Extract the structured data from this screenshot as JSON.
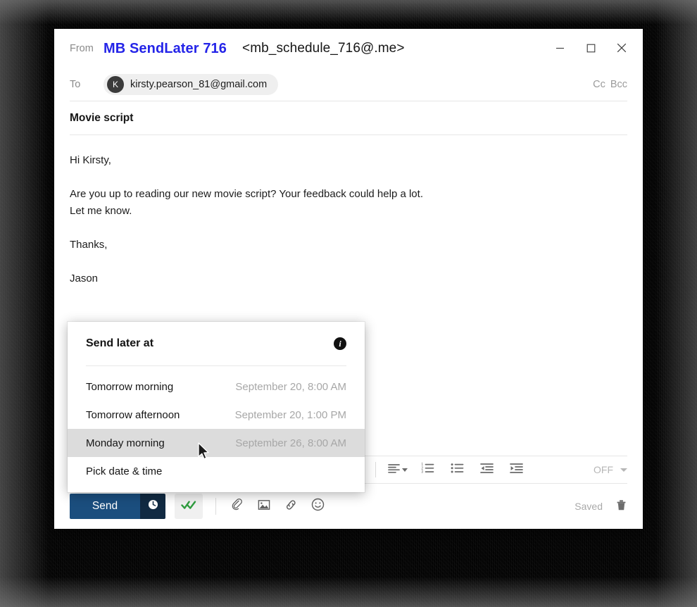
{
  "window": {
    "controls": [
      {
        "name": "minimize",
        "glyph": "minimize-icon"
      },
      {
        "name": "maximize",
        "glyph": "maximize-icon"
      },
      {
        "name": "close",
        "glyph": "close-icon"
      }
    ]
  },
  "compose": {
    "from_label": "From",
    "from_name": "MB SendLater 716",
    "from_address": "<mb_schedule_716@.me>",
    "from_name_color": "#2424e8",
    "to_label": "To",
    "to_avatar_initial": "K",
    "to_email": "kirsty.pearson_81@gmail.com",
    "cc_label": "Cc",
    "bcc_label": "Bcc",
    "subject": "Movie script",
    "body_lines": [
      "Hi Kirsty,",
      "",
      "Are you up to reading our new movie script? Your feedback could help a lot.",
      "Let me know.",
      "",
      "Thanks,",
      "",
      "Jason"
    ]
  },
  "format_toolbar": {
    "buttons": [
      {
        "name": "align-left-icon",
        "label": "Align"
      },
      {
        "name": "numbered-list-icon",
        "label": "Numbered list"
      },
      {
        "name": "bulleted-list-icon",
        "label": "Bulleted list"
      },
      {
        "name": "decrease-indent-icon",
        "label": "Decrease indent"
      },
      {
        "name": "increase-indent-icon",
        "label": "Increase indent"
      }
    ],
    "tracking_value": "OFF"
  },
  "send_bar": {
    "send_label": "Send",
    "clock_icon": "clock-icon",
    "send_later_icon": "double-check-icon",
    "send_later_color": "#2e9c3e",
    "send_button_color": "#1b4e7e",
    "send_clock_color": "#112a42",
    "attach_buttons": [
      {
        "name": "paperclip-icon",
        "label": "Attach file"
      },
      {
        "name": "image-icon",
        "label": "Insert image"
      },
      {
        "name": "link-icon",
        "label": "Insert link"
      },
      {
        "name": "emoji-icon",
        "label": "Insert emoji"
      }
    ],
    "saved_text": "Saved",
    "trash_icon": "trash-icon"
  },
  "dropdown": {
    "title": "Send later at",
    "info_icon": "info-icon",
    "info_glyph": "i",
    "items": [
      {
        "label": "Tomorrow morning",
        "value": "September 20, 8:00 AM",
        "highlighted": false
      },
      {
        "label": "Tomorrow afternoon",
        "value": "September 20, 1:00 PM",
        "highlighted": false
      },
      {
        "label": "Monday morning",
        "value": "September 26, 8:00 AM",
        "highlighted": true
      },
      {
        "label": "Pick date & time",
        "value": "",
        "highlighted": false
      }
    ]
  }
}
